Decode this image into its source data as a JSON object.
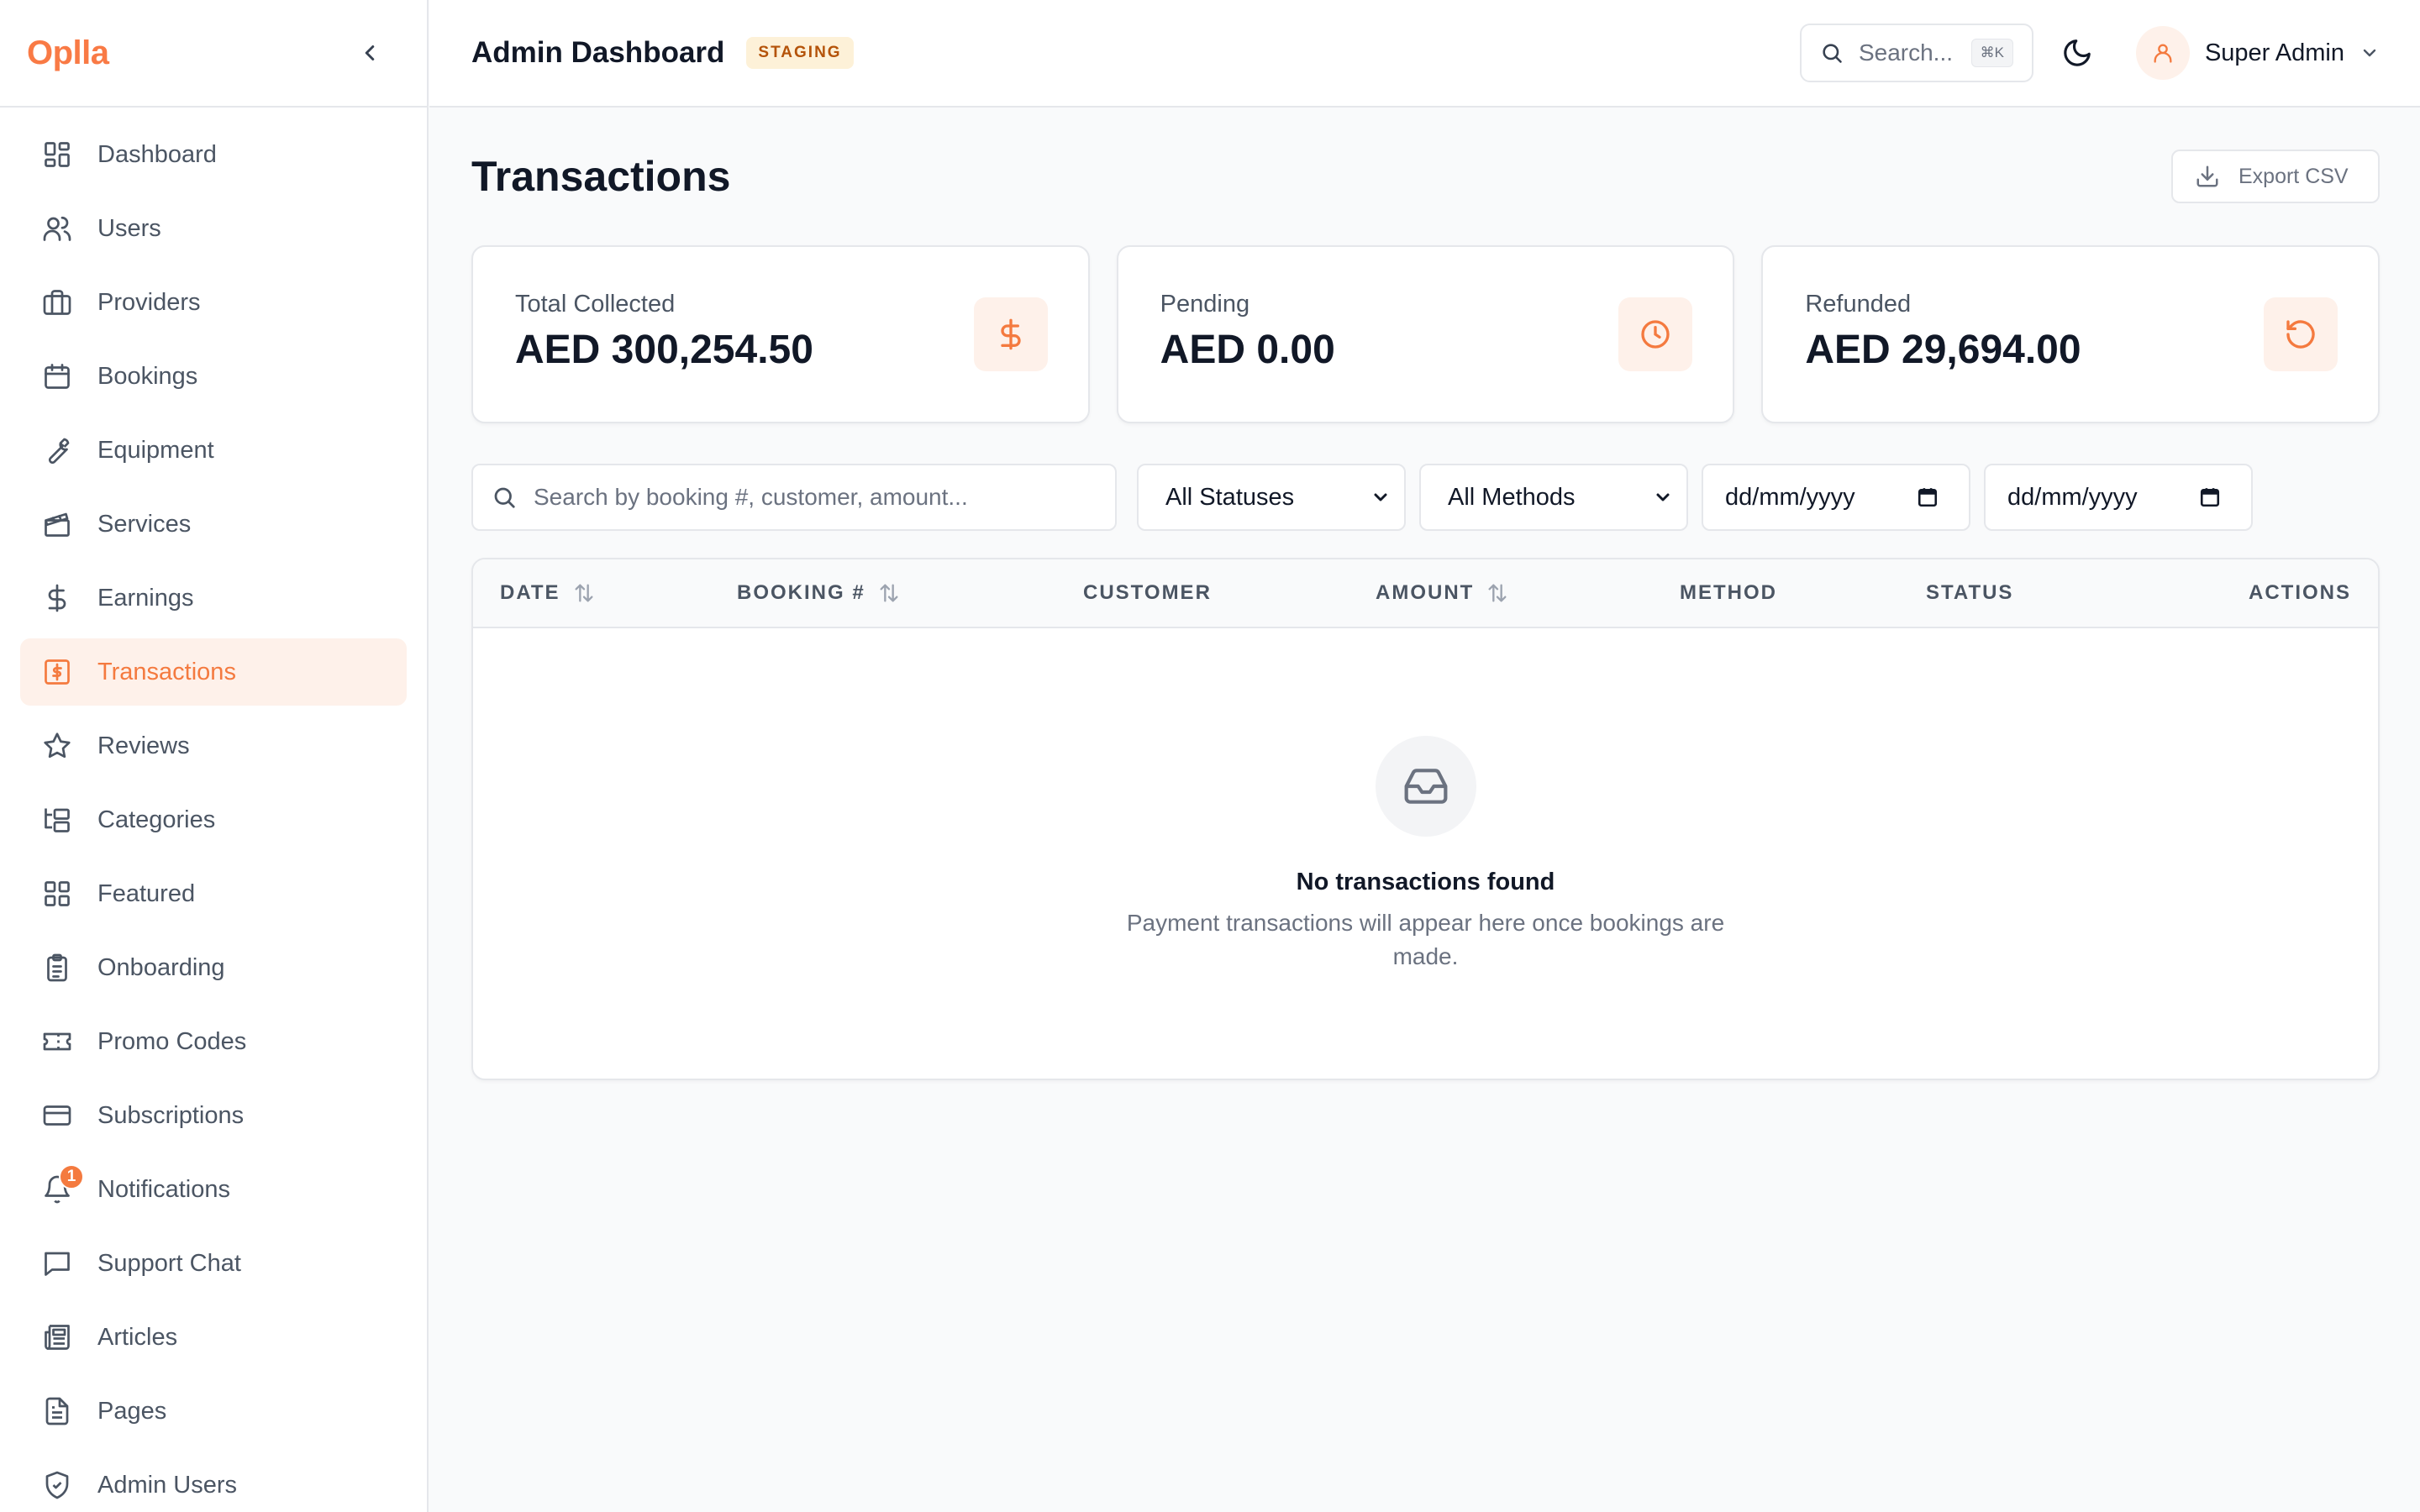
{
  "sidebar": {
    "brand": "Oplla",
    "items": [
      {
        "label": "Dashboard"
      },
      {
        "label": "Users"
      },
      {
        "label": "Providers"
      },
      {
        "label": "Bookings"
      },
      {
        "label": "Equipment"
      },
      {
        "label": "Services"
      },
      {
        "label": "Earnings"
      },
      {
        "label": "Transactions",
        "active": true
      },
      {
        "label": "Reviews"
      },
      {
        "label": "Categories"
      },
      {
        "label": "Featured"
      },
      {
        "label": "Onboarding"
      },
      {
        "label": "Promo Codes"
      },
      {
        "label": "Subscriptions"
      },
      {
        "label": "Notifications",
        "badge": "1"
      },
      {
        "label": "Support Chat"
      },
      {
        "label": "Articles"
      },
      {
        "label": "Pages"
      },
      {
        "label": "Admin Users"
      }
    ]
  },
  "topbar": {
    "title": "Admin Dashboard",
    "env_badge": "STAGING",
    "search_placeholder": "Search...",
    "search_shortcut": "⌘K",
    "user_name": "Super Admin"
  },
  "page": {
    "title": "Transactions",
    "export_label": "Export CSV"
  },
  "stats": [
    {
      "label": "Total Collected",
      "value": "AED 300,254.50",
      "icon": "dollar-icon"
    },
    {
      "label": "Pending",
      "value": "AED 0.00",
      "icon": "clock-icon"
    },
    {
      "label": "Refunded",
      "value": "AED 29,694.00",
      "icon": "refund-icon"
    }
  ],
  "filters": {
    "search_placeholder": "Search by booking #, customer, amount...",
    "status_selected": "All Statuses",
    "method_selected": "All Methods",
    "date_from": "dd/mm/yyyy",
    "date_to": "dd/mm/yyyy"
  },
  "table": {
    "columns": [
      "DATE",
      "BOOKING #",
      "CUSTOMER",
      "AMOUNT",
      "METHOD",
      "STATUS",
      "ACTIONS"
    ],
    "rows": [],
    "empty_title": "No transactions found",
    "empty_subtitle": "Payment transactions will appear here once bookings are made."
  },
  "colors": {
    "accent": "#f47a3f",
    "accent_soft": "#fef1ea",
    "staging_bg": "#fdf1d8",
    "staging_text": "#b45309"
  }
}
